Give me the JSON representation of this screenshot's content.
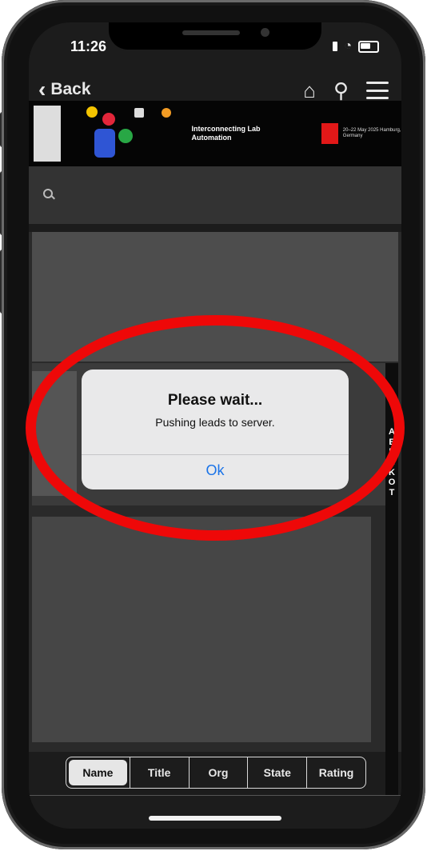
{
  "status_bar": {
    "time": "11:26"
  },
  "nav": {
    "back_label": "Back"
  },
  "banner": {
    "title": "Interconnecting Lab Automation",
    "date": "20–22 May 2025 Hamburg, Germany"
  },
  "alert": {
    "title": "Please wait...",
    "message": "Pushing leads to server.",
    "ok_label": "Ok"
  },
  "side_letters": [
    "A",
    "E",
    "",
    "E",
    "H",
    "K",
    "O",
    "T"
  ],
  "sort_tabs": [
    {
      "label": "Name",
      "active": true
    },
    {
      "label": "Title",
      "active": false
    },
    {
      "label": "Org",
      "active": false
    },
    {
      "label": "State",
      "active": false
    },
    {
      "label": "Rating",
      "active": false
    }
  ],
  "colors": {
    "highlight": "#ee0808",
    "ok_blue": "#1a73e8"
  }
}
